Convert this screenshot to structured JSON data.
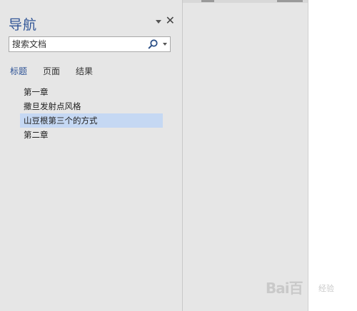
{
  "nav_pane": {
    "title": "导航",
    "search": {
      "value": "",
      "placeholder": "搜索文档"
    },
    "tabs": [
      {
        "label": "标题",
        "active": true
      },
      {
        "label": "页面",
        "active": false
      },
      {
        "label": "结果",
        "active": false
      }
    ],
    "headings": [
      {
        "label": "第一章",
        "selected": false
      },
      {
        "label": "撒旦发射点风格",
        "selected": false
      },
      {
        "label": "山豆根第三个的方式",
        "selected": true
      },
      {
        "label": "第二章",
        "selected": false
      }
    ]
  },
  "watermark": {
    "logo_text": "Bai",
    "logo_text_2": "百",
    "sub_text": "经验"
  },
  "colors": {
    "accent": "#2f5496",
    "selected_row": "#c5d8f3",
    "pane_bg": "#e6e6e6"
  },
  "icons": {
    "pane_options": "chevron-down-icon",
    "pane_close": "close-icon",
    "search": "search-icon",
    "search_options": "chevron-down-icon"
  }
}
